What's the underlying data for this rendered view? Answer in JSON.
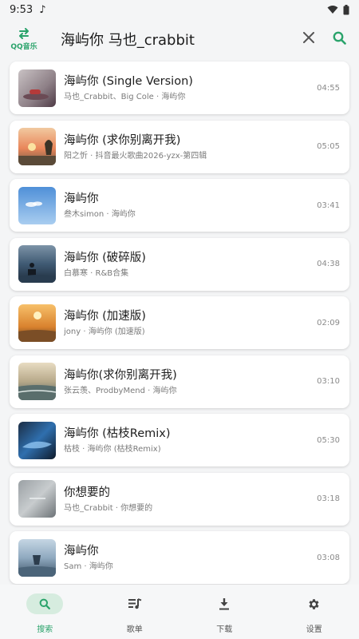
{
  "status_bar": {
    "time": "9:53",
    "note_icon": "music-note-icon"
  },
  "brand": {
    "label": "QQ音乐",
    "icon": "swap-arrows-icon"
  },
  "search": {
    "query": "海屿你 马也_crabbit",
    "clear_icon": "close-icon",
    "search_icon": "search-icon"
  },
  "songs": [
    {
      "title": "海屿你 (Single Version)",
      "subtitle": "马也_Crabbit、Big Cole · 海屿你",
      "duration": "04:55"
    },
    {
      "title": "海屿你 (求你别离开我)",
      "subtitle": "阳之忻 · 抖音最火歌曲2026-yzx-第四辑",
      "duration": "05:05"
    },
    {
      "title": "海屿你",
      "subtitle": "叁木simon · 海屿你",
      "duration": "03:41"
    },
    {
      "title": "海屿你 (破碎版)",
      "subtitle": "白慕寒 · R&B合集",
      "duration": "04:38"
    },
    {
      "title": "海屿你 (加速版)",
      "subtitle": "jony · 海屿你 (加速版)",
      "duration": "02:09"
    },
    {
      "title": "海屿你(求你别离开我)",
      "subtitle": "张云羡、ProdbyMend · 海屿你",
      "duration": "03:10"
    },
    {
      "title": "海屿你 (枯枝Remix)",
      "subtitle": "枯枝 · 海屿你 (枯枝Remix)",
      "duration": "05:30"
    },
    {
      "title": "你想要的",
      "subtitle": "马也_Crabbit · 你想要的",
      "duration": "03:18"
    },
    {
      "title": "海屿你",
      "subtitle": "Sam · 海屿你",
      "duration": "03:08"
    }
  ],
  "nav": [
    {
      "label": "搜索",
      "icon": "search-icon",
      "active": true
    },
    {
      "label": "歌单",
      "icon": "playlist-icon",
      "active": false
    },
    {
      "label": "下载",
      "icon": "download-icon",
      "active": false
    },
    {
      "label": "设置",
      "icon": "gear-icon",
      "active": false
    }
  ],
  "colors": {
    "accent": "#2aa36b",
    "background": "#f4f5f6",
    "card": "#ffffff"
  }
}
